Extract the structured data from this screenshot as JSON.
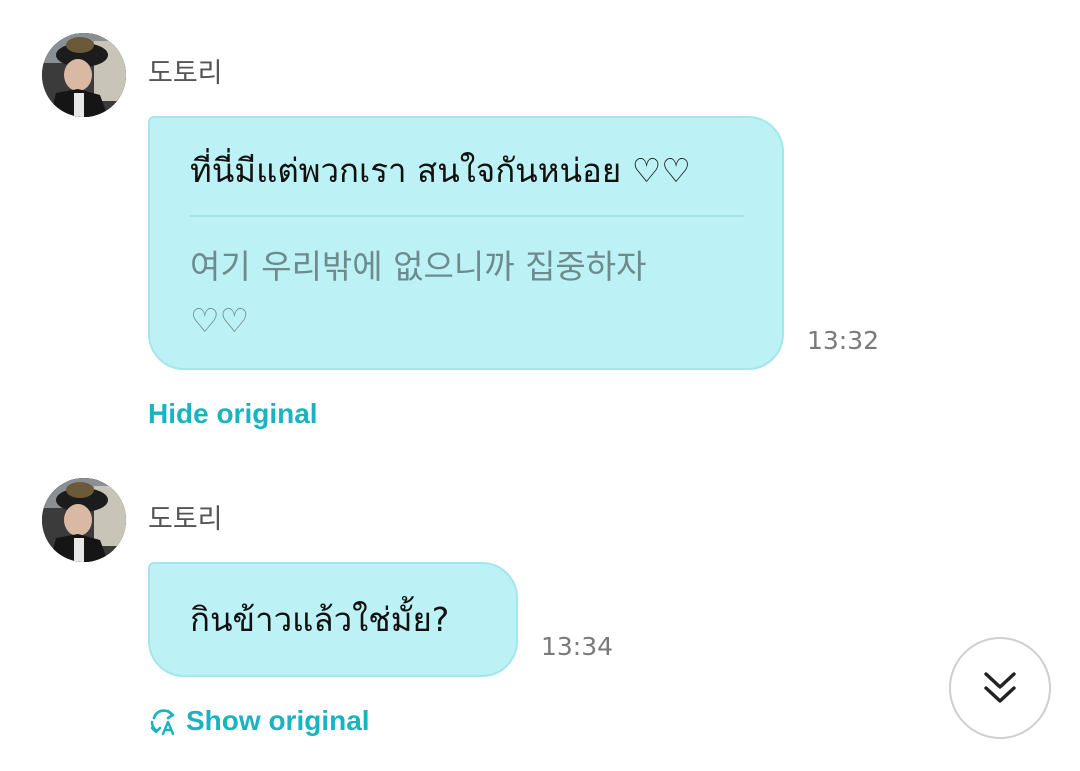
{
  "messages": [
    {
      "sender": "도토리",
      "text": "ที่นี่มีแต่พวกเรา สนใจกันหน่อย ♡♡",
      "original_line1": "여기 우리밖에 없으니까 집중하자",
      "original_line2": "♡♡",
      "time": "13:32",
      "toggle_label": "Hide original"
    },
    {
      "sender": "도토리",
      "text": "กินข้าวแล้วใช่มั้ย?",
      "time": "13:34",
      "toggle_label": "Show original"
    }
  ],
  "icons": {
    "translate_toggle": "translate-refresh-icon",
    "scroll_down": "double-chevron-down-icon"
  },
  "colors": {
    "bubble": "#bcf2f5",
    "link": "#19b3c1"
  }
}
